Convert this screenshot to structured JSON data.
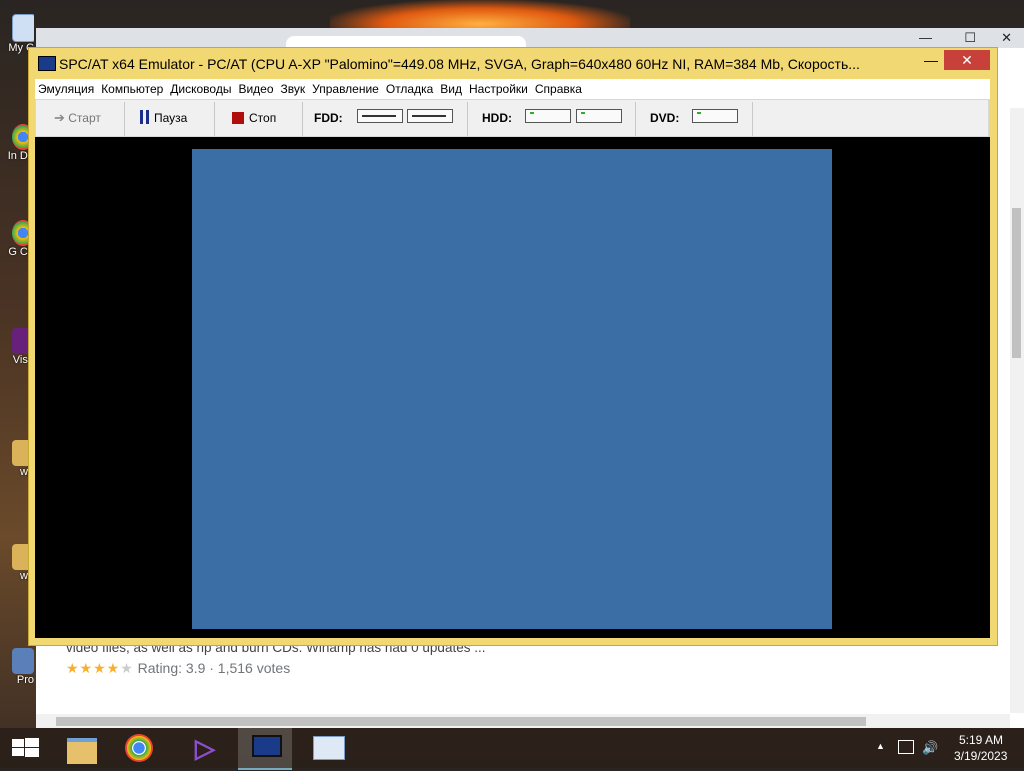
{
  "desktop": {
    "icons": [
      {
        "label": "My C",
        "icon": "computer-icon"
      },
      {
        "label": "In Do",
        "icon": "chrome-icon"
      },
      {
        "label": "G Ch",
        "icon": "chrome-icon"
      },
      {
        "label": "Visu",
        "icon": "visual-studio-icon"
      },
      {
        "label": "wp",
        "icon": "folder-icon"
      },
      {
        "label": "wp",
        "icon": "folder-icon"
      },
      {
        "label": "Pro",
        "icon": "app-icon"
      }
    ]
  },
  "browser": {
    "snippet": "video files, as well as rip and burn CDs. Winamp has had 0 updates ...",
    "rating_text": "Rating: 3.9 · 1,516 votes",
    "stars_on": "★★★★",
    "stars_off": "★",
    "rating_value": 3.9,
    "min_label": "—",
    "max_label": "☐",
    "close_label": "✕"
  },
  "emulator": {
    "title": "SPC/AT x64 Emulator - PC/AT (CPU A-XP \"Palomino\"=449.08 MHz, SVGA, Graph=640x480 60Hz NI, RAM=384 Mb, Скорость...",
    "min_label": "—",
    "max_label": "☐",
    "close_label": "✕",
    "menu": [
      "Эмуляция",
      "Компьютер",
      "Дисководы",
      "Видео",
      "Звук",
      "Управление",
      "Отладка",
      "Вид",
      "Настройки",
      "Справка"
    ],
    "toolbar": {
      "start": "Старт",
      "pause": "Пауза",
      "stop": "Стоп",
      "fdd": "FDD:",
      "hdd": "HDD:",
      "dvd": "DVD:"
    },
    "guest_screen_color": "#3a6ea5"
  },
  "taskbar": {
    "apps": [
      "start-icon",
      "file-explorer-icon",
      "chrome-icon",
      "visual-studio-icon",
      "emulator-icon",
      "keyboard-app-icon"
    ],
    "time": "5:19 AM",
    "date": "3/19/2023",
    "tray_arrow": "▲"
  }
}
